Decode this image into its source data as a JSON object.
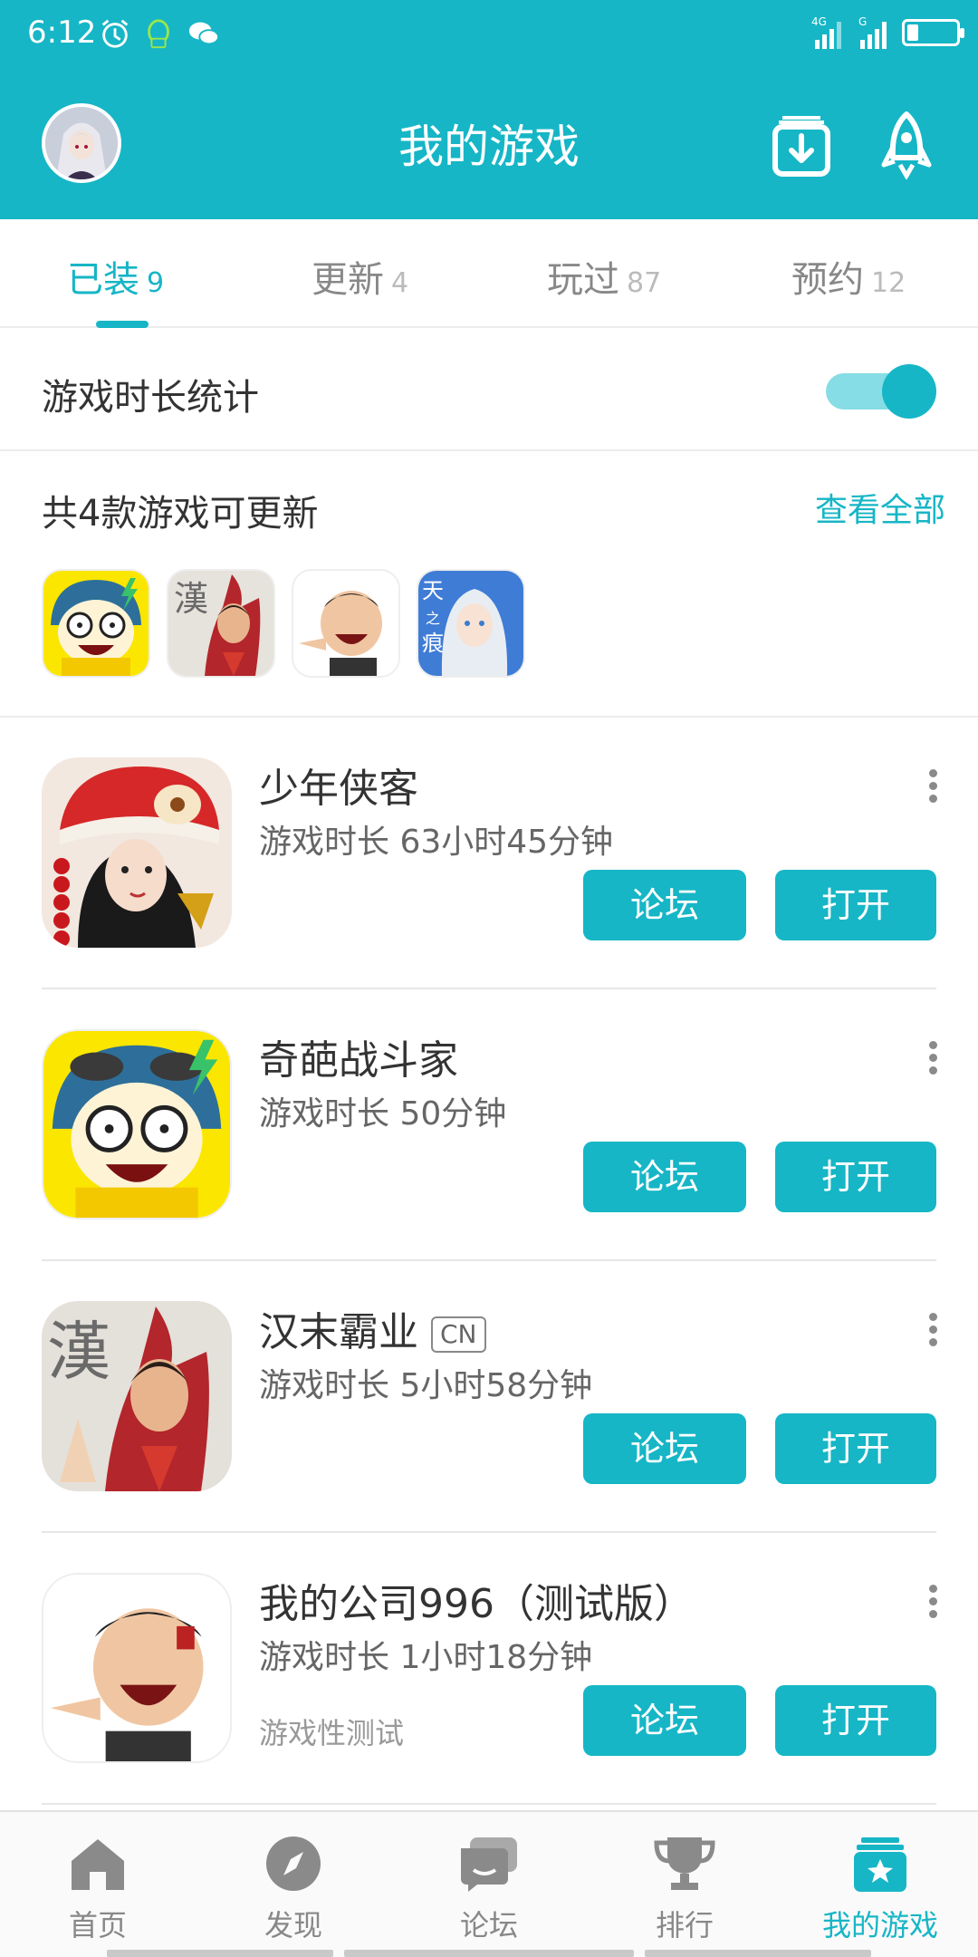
{
  "status_bar": {
    "time": "6:12",
    "network": "4G"
  },
  "header": {
    "title": "我的游戏",
    "download_icon": "download-box-icon",
    "rocket_icon": "rocket-icon"
  },
  "tabs": [
    {
      "label": "已装",
      "count": "9",
      "active": true
    },
    {
      "label": "更新",
      "count": "4",
      "active": false
    },
    {
      "label": "玩过",
      "count": "87",
      "active": false
    },
    {
      "label": "预约",
      "count": "12",
      "active": false
    }
  ],
  "playtime_stats": {
    "label": "游戏时长统计",
    "enabled": true
  },
  "updates": {
    "title": "共4款游戏可更新",
    "view_all": "查看全部"
  },
  "games": [
    {
      "name": "少年侠客",
      "tag": "",
      "playtime": "游戏时长 63小时45分钟",
      "note": "",
      "forum_label": "论坛",
      "open_label": "打开"
    },
    {
      "name": "奇葩战斗家",
      "tag": "",
      "playtime": "游戏时长 50分钟",
      "note": "",
      "forum_label": "论坛",
      "open_label": "打开"
    },
    {
      "name": "汉末霸业",
      "tag": "CN",
      "playtime": "游戏时长 5小时58分钟",
      "note": "",
      "forum_label": "论坛",
      "open_label": "打开"
    },
    {
      "name": "我的公司996（测试版）",
      "tag": "",
      "playtime": "游戏时长 1小时18分钟",
      "note": "游戏性测试",
      "forum_label": "论坛",
      "open_label": "打开"
    }
  ],
  "bottom_nav": [
    {
      "label": "首页",
      "icon": "home-icon",
      "active": false
    },
    {
      "label": "发现",
      "icon": "compass-icon",
      "active": false
    },
    {
      "label": "论坛",
      "icon": "chat-icon",
      "active": false
    },
    {
      "label": "排行",
      "icon": "trophy-icon",
      "active": false
    },
    {
      "label": "我的游戏",
      "icon": "my-games-star-icon",
      "active": true
    }
  ],
  "colors": {
    "accent": "#16b6c6",
    "text_primary": "#333333",
    "text_secondary": "#666666"
  }
}
